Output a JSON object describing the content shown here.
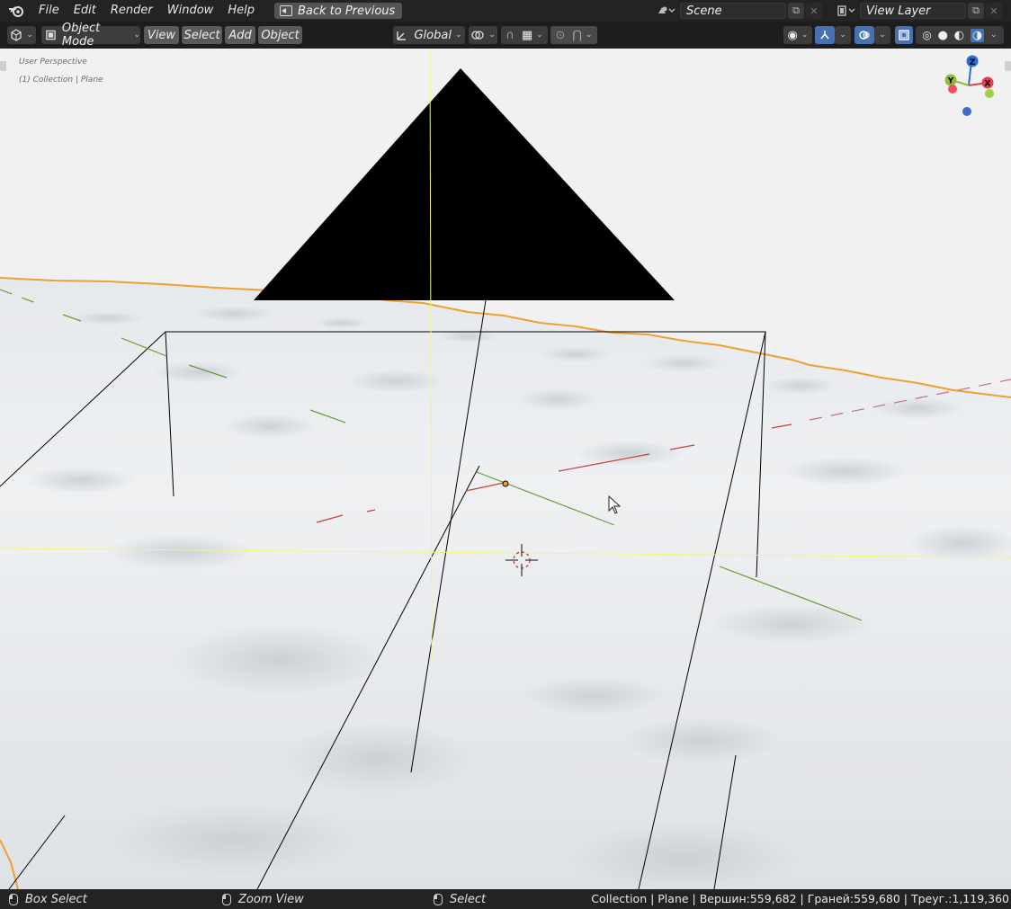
{
  "menubar": {
    "items": [
      "File",
      "Edit",
      "Render",
      "Window",
      "Help"
    ],
    "back_button": "Back to Previous",
    "scene": "Scene",
    "view_layer": "View Layer"
  },
  "viewport_header": {
    "mode": "Object Mode",
    "menus": [
      "View",
      "Select",
      "Add",
      "Object"
    ],
    "transform_orientation": "Global"
  },
  "viewport": {
    "perspective_label": "User Perspective",
    "collection_label": "(1) Collection | Plane",
    "gizmo": {
      "z": "Z",
      "y": "Y",
      "x": "X"
    }
  },
  "statusbar": {
    "box_select": "Box Select",
    "zoom_view": "Zoom View",
    "select": "Select",
    "stats": "Collection | Plane | Вершин:559,682 | Граней:559,680 | Треуг.:1,119,360"
  },
  "colors": {
    "accent_blue": "#4672b4",
    "outline_orange": "#f0a030",
    "axis_red": "#c84040",
    "axis_green": "#6a9a3a"
  }
}
